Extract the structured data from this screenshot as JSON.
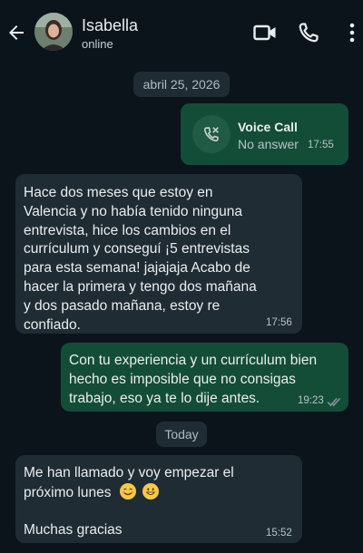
{
  "contact": {
    "name": "Isabella",
    "status": "online"
  },
  "header_icons": [
    "back-arrow-icon",
    "video-call-icon",
    "phone-icon",
    "more-options-icon"
  ],
  "dates": {
    "first": "abril 25, 2026",
    "second": "Today"
  },
  "messages": [
    {
      "type": "voice_call",
      "direction": "outgoing",
      "title": "Voice Call",
      "subtitle": "No answer",
      "time": "17:55"
    },
    {
      "direction": "incoming",
      "text": "Hace dos meses que estoy en\nValencia y no había tenido ninguna\nentrevista, hice los cambios en el\ncurrículum y conseguí ¡5 entrevistas\npara esta semana! jajajaja Acabo de\nhacer la primera y tengo dos mañana\ny dos pasado mañana, estoy re\nconfiado.",
      "time": "17:56"
    },
    {
      "direction": "outgoing",
      "text": "Con tu experiencia y un currículum bien\nhecho es imposible que no consigas\ntrabajo, eso ya te lo dije antes.",
      "time": "19:23",
      "status": "read"
    },
    {
      "direction": "incoming",
      "line1": "Me han llamado y voy empezar el",
      "line2": "próximo lunes",
      "emojis": [
        "smiling-face-emoji",
        "grinning-face-emoji"
      ],
      "line3": "Muchas gracias",
      "time": "15:52"
    }
  ],
  "colors": {
    "background": "#0b141a",
    "outgoing_bubble": "#144d37",
    "incoming_bubble": "#202c33",
    "read_ticks": "#8696a0"
  }
}
